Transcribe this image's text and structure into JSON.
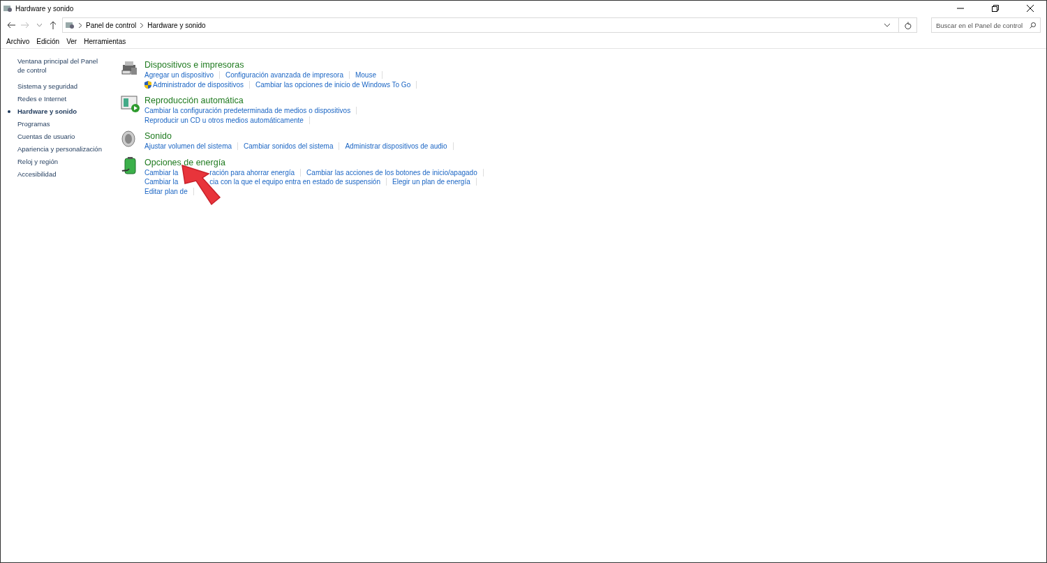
{
  "window": {
    "title": "Hardware y sonido"
  },
  "address_bar": {
    "breadcrumbs": [
      "Panel de control",
      "Hardware y sonido"
    ]
  },
  "search": {
    "placeholder": "Buscar en el Panel de control"
  },
  "menu": [
    "Archivo",
    "Edición",
    "Ver",
    "Herramientas"
  ],
  "sidebar": {
    "items": [
      {
        "label": "Ventana principal del Panel de control",
        "selected": false
      },
      {
        "label": "Sistema y seguridad",
        "selected": false
      },
      {
        "label": "Redes e Internet",
        "selected": false
      },
      {
        "label": "Hardware y sonido",
        "selected": true
      },
      {
        "label": "Programas",
        "selected": false
      },
      {
        "label": "Cuentas de usuario",
        "selected": false
      },
      {
        "label": "Apariencia y personalización",
        "selected": false
      },
      {
        "label": "Reloj y región",
        "selected": false
      },
      {
        "label": "Accesibilidad",
        "selected": false
      }
    ]
  },
  "sections": [
    {
      "kind": "devices",
      "title": "Dispositivos e impresoras",
      "rows": [
        [
          {
            "parts": [
              "Agregar un dispositivo"
            ]
          },
          {
            "parts": [
              "Configuración avanzada de impresora"
            ]
          },
          {
            "parts": [
              "Mouse"
            ]
          }
        ],
        [
          {
            "parts": [
              "Administrador de dispositivos"
            ],
            "kind": "shield"
          },
          {
            "parts": [
              "Cambiar las opciones de inicio de Windows To Go"
            ]
          }
        ]
      ]
    },
    {
      "kind": "autoplay",
      "title": "Reproducción automática",
      "rows": [
        [
          {
            "parts": [
              "Cambiar la configuración predeterminada de medios o dispositivos"
            ]
          }
        ],
        [
          {
            "parts": [
              "Reproducir un CD u otros medios automáticamente"
            ]
          }
        ]
      ]
    },
    {
      "kind": "sound",
      "title": "Sonido",
      "rows": [
        [
          {
            "parts": [
              "Ajustar volumen del sistema"
            ]
          },
          {
            "parts": [
              "Cambiar sonidos del sistema"
            ]
          },
          {
            "parts": [
              "Administrar dispositivos de audio"
            ]
          }
        ]
      ]
    },
    {
      "kind": "power",
      "title": "Opciones de energía",
      "rows": [
        [
          {
            "parts": [
              "Cambiar la",
              "ración para ahorrar energía"
            ]
          },
          {
            "parts": [
              "Cambiar las acciones de los botones de inicio/apagado"
            ]
          }
        ],
        [
          {
            "parts": [
              "Cambiar la",
              "cia con la que el equipo entra en estado de suspensión"
            ]
          },
          {
            "parts": [
              "Elegir un plan de energía"
            ]
          }
        ],
        [
          {
            "parts": [
              "Editar plan de"
            ]
          }
        ]
      ]
    }
  ]
}
